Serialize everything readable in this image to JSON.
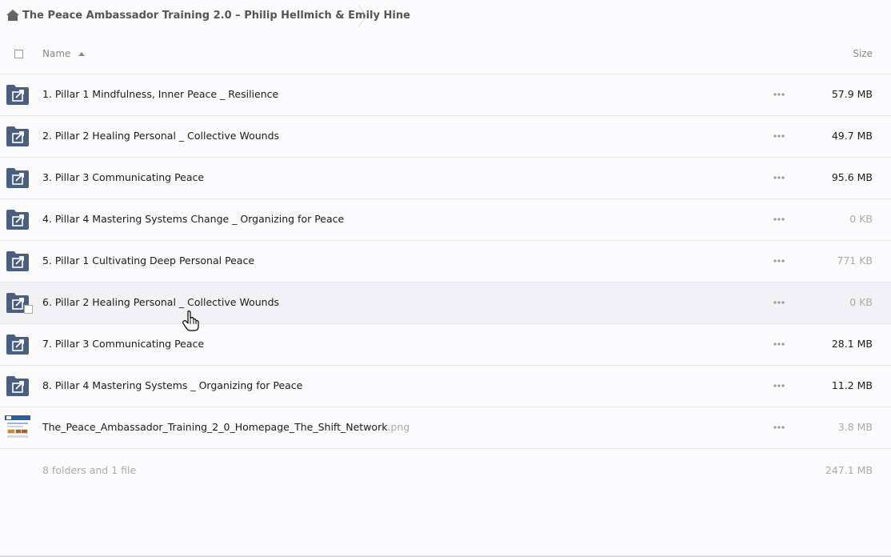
{
  "breadcrumb": {
    "home_icon": "home-icon",
    "current": "The Peace Ambassador Training 2.0 – Philip Hellmich & Emily Hine"
  },
  "header": {
    "name_label": "Name",
    "size_label": "Size",
    "sort": "ascending"
  },
  "rows": [
    {
      "name": "1. Pillar 1 Mindfulness, Inner Peace _ Resilience",
      "ext": "",
      "size": "57.9 MB",
      "type": "shared-folder"
    },
    {
      "name": "2. Pillar 2 Healing Personal _ Collective Wounds",
      "ext": "",
      "size": "49.7 MB",
      "type": "shared-folder"
    },
    {
      "name": "3. Pillar 3 Communicating Peace",
      "ext": "",
      "size": "95.6 MB",
      "type": "shared-folder"
    },
    {
      "name": "4. Pillar 4 Mastering Systems Change _ Organizing for Peace",
      "ext": "",
      "size": "0 KB",
      "type": "shared-folder"
    },
    {
      "name": "5. Pillar 1 Cultivating Deep Personal Peace",
      "ext": "",
      "size": "771 KB",
      "type": "shared-folder"
    },
    {
      "name": "6. Pillar 2 Healing Personal _ Collective Wounds",
      "ext": "",
      "size": "0 KB",
      "type": "shared-folder"
    },
    {
      "name": "7. Pillar 3 Communicating Peace",
      "ext": "",
      "size": "28.1 MB",
      "type": "shared-folder"
    },
    {
      "name": "8. Pillar 4 Mastering Systems _ Organizing for Peace",
      "ext": "",
      "size": "11.2 MB",
      "type": "shared-folder"
    },
    {
      "name": "The_Peace_Ambassador_Training_2_0_Homepage_The_Shift_Network",
      "ext": ".png",
      "size": "3.8 MB",
      "type": "image-file"
    }
  ],
  "summary": {
    "text": "8 folders and 1 file",
    "total_size": "247.1 MB"
  },
  "colors": {
    "folder": "#4a5f7d",
    "muted_text": "#aaaaaa",
    "row_border": "#e7e7ea",
    "hover_row": "#f2f2f5"
  }
}
